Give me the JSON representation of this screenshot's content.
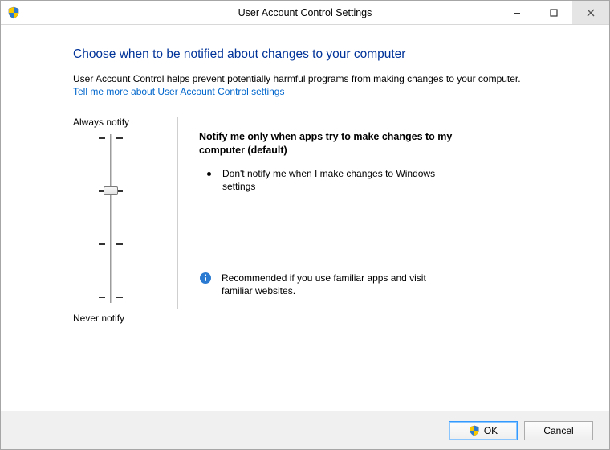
{
  "window": {
    "title": "User Account Control Settings"
  },
  "header": {
    "instruction": "Choose when to be notified about changes to your computer",
    "description": "User Account Control helps prevent potentially harmful programs from making changes to your computer.",
    "help_link": "Tell me more about User Account Control settings"
  },
  "slider": {
    "top_label": "Always notify",
    "bottom_label": "Never notify",
    "levels": 4,
    "current_level_index": 1
  },
  "level_info": {
    "title": "Notify me only when apps try to make changes to my computer (default)",
    "bullet": "Don't notify me when I make changes to Windows settings",
    "recommendation": "Recommended if you use familiar apps and visit familiar websites."
  },
  "buttons": {
    "ok": "OK",
    "cancel": "Cancel"
  }
}
